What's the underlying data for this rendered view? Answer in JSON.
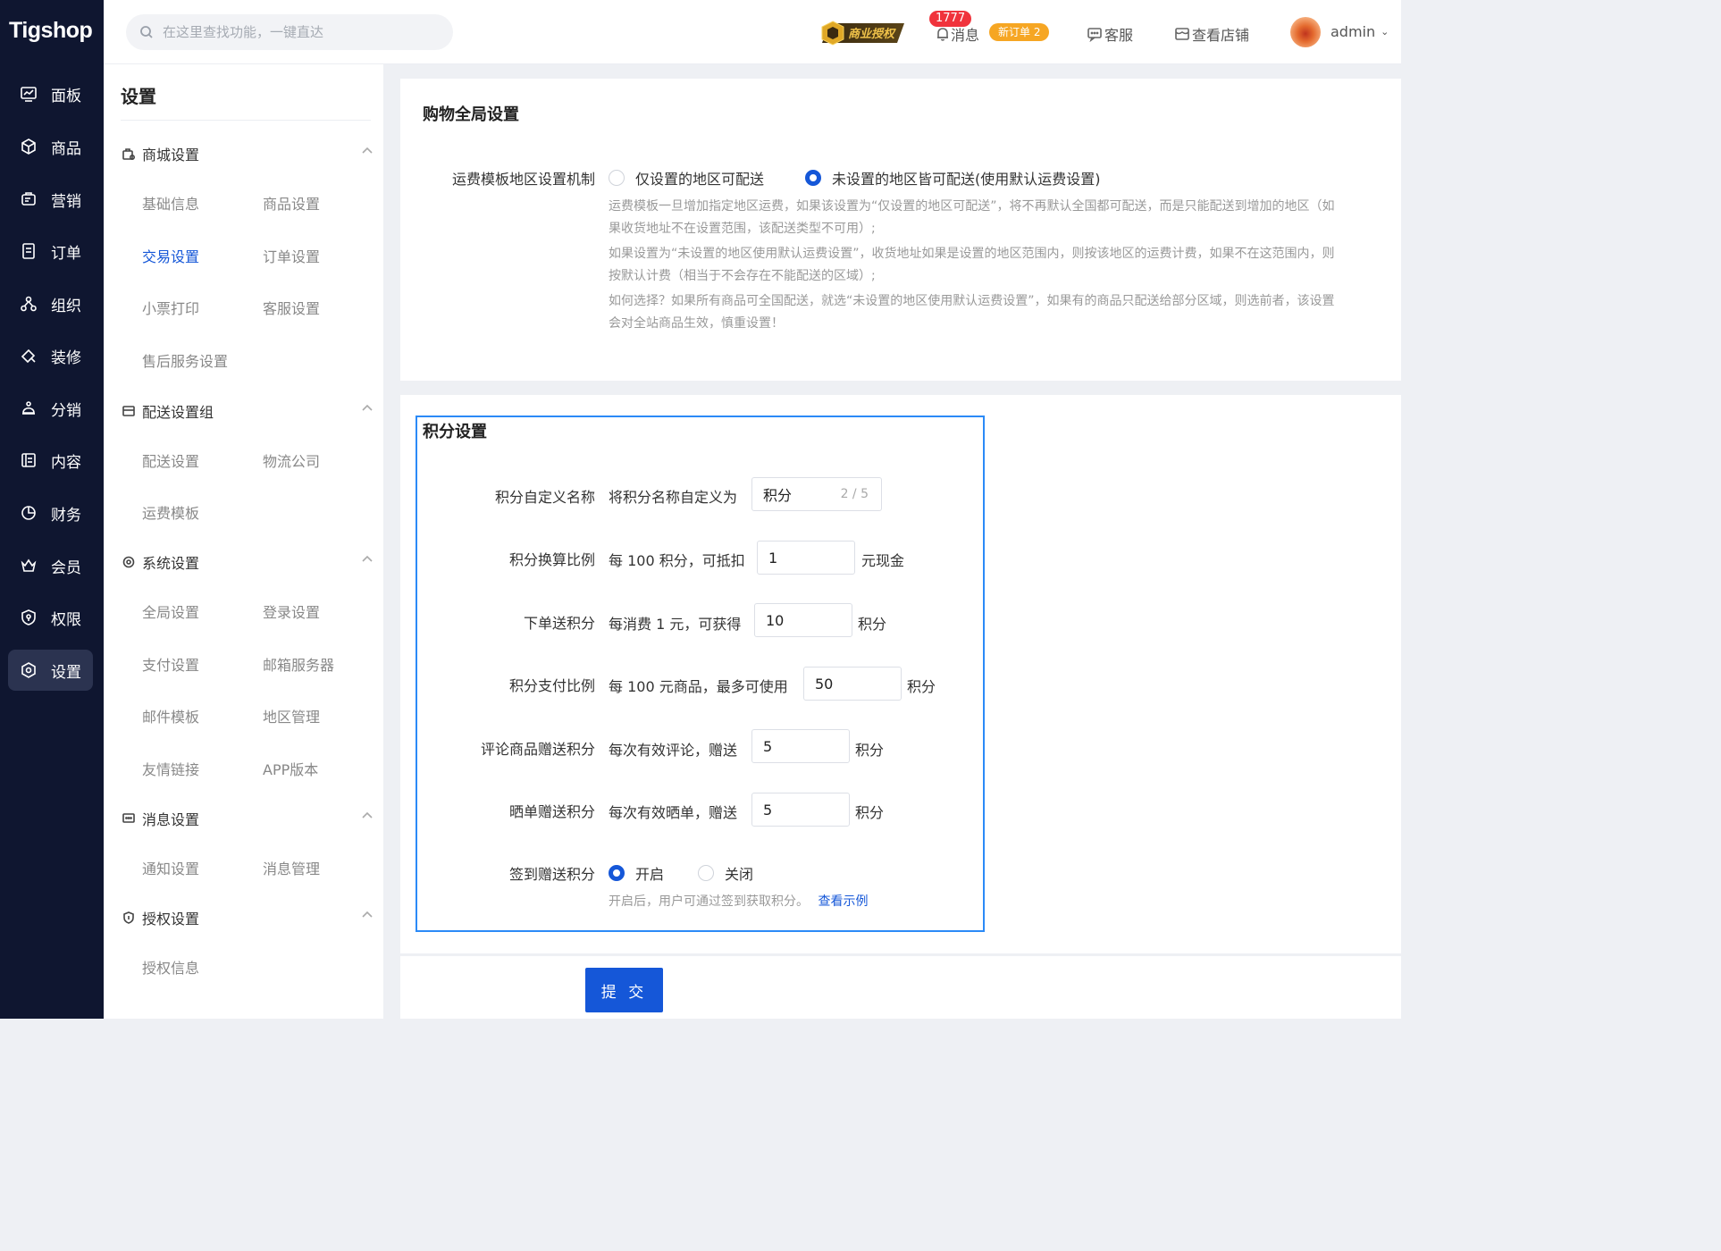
{
  "app": {
    "logo": "Tigshop"
  },
  "sidebar": {
    "items": [
      {
        "label": "面板",
        "icon": "dashboard-icon"
      },
      {
        "label": "商品",
        "icon": "box-icon"
      },
      {
        "label": "营销",
        "icon": "marketing-icon"
      },
      {
        "label": "订单",
        "icon": "order-icon"
      },
      {
        "label": "组织",
        "icon": "org-icon"
      },
      {
        "label": "装修",
        "icon": "decorate-icon"
      },
      {
        "label": "分销",
        "icon": "distribution-icon"
      },
      {
        "label": "内容",
        "icon": "content-icon"
      },
      {
        "label": "财务",
        "icon": "finance-icon"
      },
      {
        "label": "会员",
        "icon": "member-icon"
      },
      {
        "label": "权限",
        "icon": "permission-icon"
      },
      {
        "label": "设置",
        "icon": "settings-icon",
        "active": true
      }
    ]
  },
  "header": {
    "search_placeholder": "在这里查找功能，一键直达",
    "license_badge": "商业授权",
    "message_label": "消息",
    "message_count": "1777",
    "new_order_badge": "新订单 2",
    "service_label": "客服",
    "store_label": "查看店铺",
    "user_name": "admin"
  },
  "subnav": {
    "title": "设置",
    "groups": [
      {
        "label": "商城设置",
        "icon": "shop-settings-icon",
        "links": [
          "基础信息",
          "商品设置",
          "交易设置",
          "订单设置",
          "小票打印",
          "客服设置",
          "售后服务设置"
        ]
      },
      {
        "label": "配送设置组",
        "icon": "delivery-icon",
        "links": [
          "配送设置",
          "物流公司",
          "运费模板"
        ]
      },
      {
        "label": "系统设置",
        "icon": "system-icon",
        "links": [
          "全局设置",
          "登录设置",
          "支付设置",
          "邮箱服务器",
          "邮件模板",
          "地区管理",
          "友情链接",
          "APP版本"
        ]
      },
      {
        "label": "消息设置",
        "icon": "message-settings-icon",
        "links": [
          "通知设置",
          "消息管理"
        ]
      },
      {
        "label": "授权设置",
        "icon": "license-icon",
        "links": [
          "授权信息"
        ]
      }
    ],
    "active_link": "交易设置"
  },
  "shopping": {
    "title": "购物全局设置",
    "shipping_label": "运费模板地区设置机制",
    "option_a": "仅设置的地区可配送",
    "option_b": "未设置的地区皆可配送(使用默认运费设置)",
    "selected": "option_b",
    "hint1a": "运费模板一旦增加指定地区运费，如果该设置为“仅设置的地区可配送”，将不再默认全国都可配送，而是只能配送到增加的地区（如",
    "hint1b": "果收货地址不在设置范围，该配送类型不可用）;",
    "hint2a": "如果设置为“未设置的地区使用默认运费设置”，收货地址如果是设置的地区范围内，则按该地区的运费计费，如果不在这范围内，则",
    "hint2b": "按默认计费（相当于不会存在不能配送的区域）;",
    "hint3a": "如何选择？如果所有商品可全国配送，就选“未设置的地区使用默认运费设置”，如果有的商品只配送给部分区域，则选前者，该设置",
    "hint3b": "会对全站商品生效，慎重设置！"
  },
  "points": {
    "title": "积分设置",
    "name": {
      "label": "积分自定义名称",
      "prefix": "将积分名称自定义为",
      "value": "积分",
      "counter": "2 / 5"
    },
    "ratio": {
      "label": "积分换算比例",
      "prefix": "每 100 积分，可抵扣",
      "value": "1",
      "suffix": "元现金"
    },
    "order": {
      "label": "下单送积分",
      "prefix": "每消费 1 元，可获得",
      "value": "10",
      "suffix": "积分"
    },
    "pay": {
      "label": "积分支付比例",
      "prefix": "每 100 元商品，最多可使用",
      "value": "50",
      "suffix": "积分"
    },
    "comment": {
      "label": "评论商品赠送积分",
      "prefix": "每次有效评论，赠送",
      "value": "5",
      "suffix": "积分"
    },
    "show": {
      "label": "晒单赠送积分",
      "prefix": "每次有效晒单，赠送",
      "value": "5",
      "suffix": "积分"
    },
    "signin": {
      "label": "签到赠送积分",
      "on": "开启",
      "off": "关闭",
      "selected": "on",
      "hint": "开启后，用户可通过签到获取积分。",
      "hint_link": "查看示例"
    }
  },
  "submit_label": "提 交",
  "colors": {
    "primary": "#1557d8",
    "sidebar": "#0f1630",
    "highlight": "#2b8af7",
    "badge_red": "#f0333c",
    "badge_orange": "#f6a623"
  }
}
